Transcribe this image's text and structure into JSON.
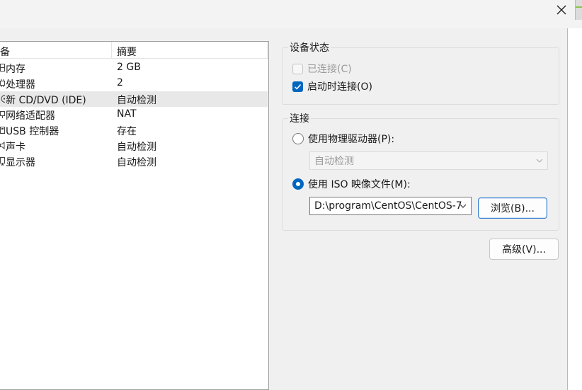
{
  "window": {
    "close_glyph": "✕"
  },
  "device_list": {
    "headers": {
      "device": "备",
      "summary": "摘要"
    },
    "rows": [
      {
        "name": "内存",
        "summary": "2 GB",
        "selected": false
      },
      {
        "name": "处理器",
        "summary": "2",
        "selected": false
      },
      {
        "name": "新 CD/DVD (IDE)",
        "summary": "自动检测",
        "selected": true
      },
      {
        "name": "网络适配器",
        "summary": "NAT",
        "selected": false
      },
      {
        "name": "USB 控制器",
        "summary": "存在",
        "selected": false
      },
      {
        "name": "声卡",
        "summary": "自动检测",
        "selected": false
      },
      {
        "name": "显示器",
        "summary": "自动检测",
        "selected": false
      }
    ]
  },
  "device_status": {
    "title": "设备状态",
    "connected": {
      "label": "已连接(C)",
      "checked": false,
      "enabled": false
    },
    "connect_at_power_on": {
      "label": "启动时连接(O)",
      "checked": true,
      "enabled": true
    }
  },
  "connection": {
    "title": "连接",
    "physical_drive": {
      "label": "使用物理驱动器(P):",
      "selected": false
    },
    "physical_drive_select": {
      "value": "自动检测",
      "enabled": false
    },
    "iso_image": {
      "label": "使用 ISO 映像文件(M):",
      "selected": true
    },
    "iso_path": {
      "value": "D:\\program\\CentOS\\CentOS-7"
    },
    "browse_label": "浏览(B)..."
  },
  "advanced_label": "高级(V)...",
  "colors": {
    "accent": "#0067c0",
    "selected_row": "#e8e8e8",
    "panel_bg": "#f0f0f0"
  }
}
